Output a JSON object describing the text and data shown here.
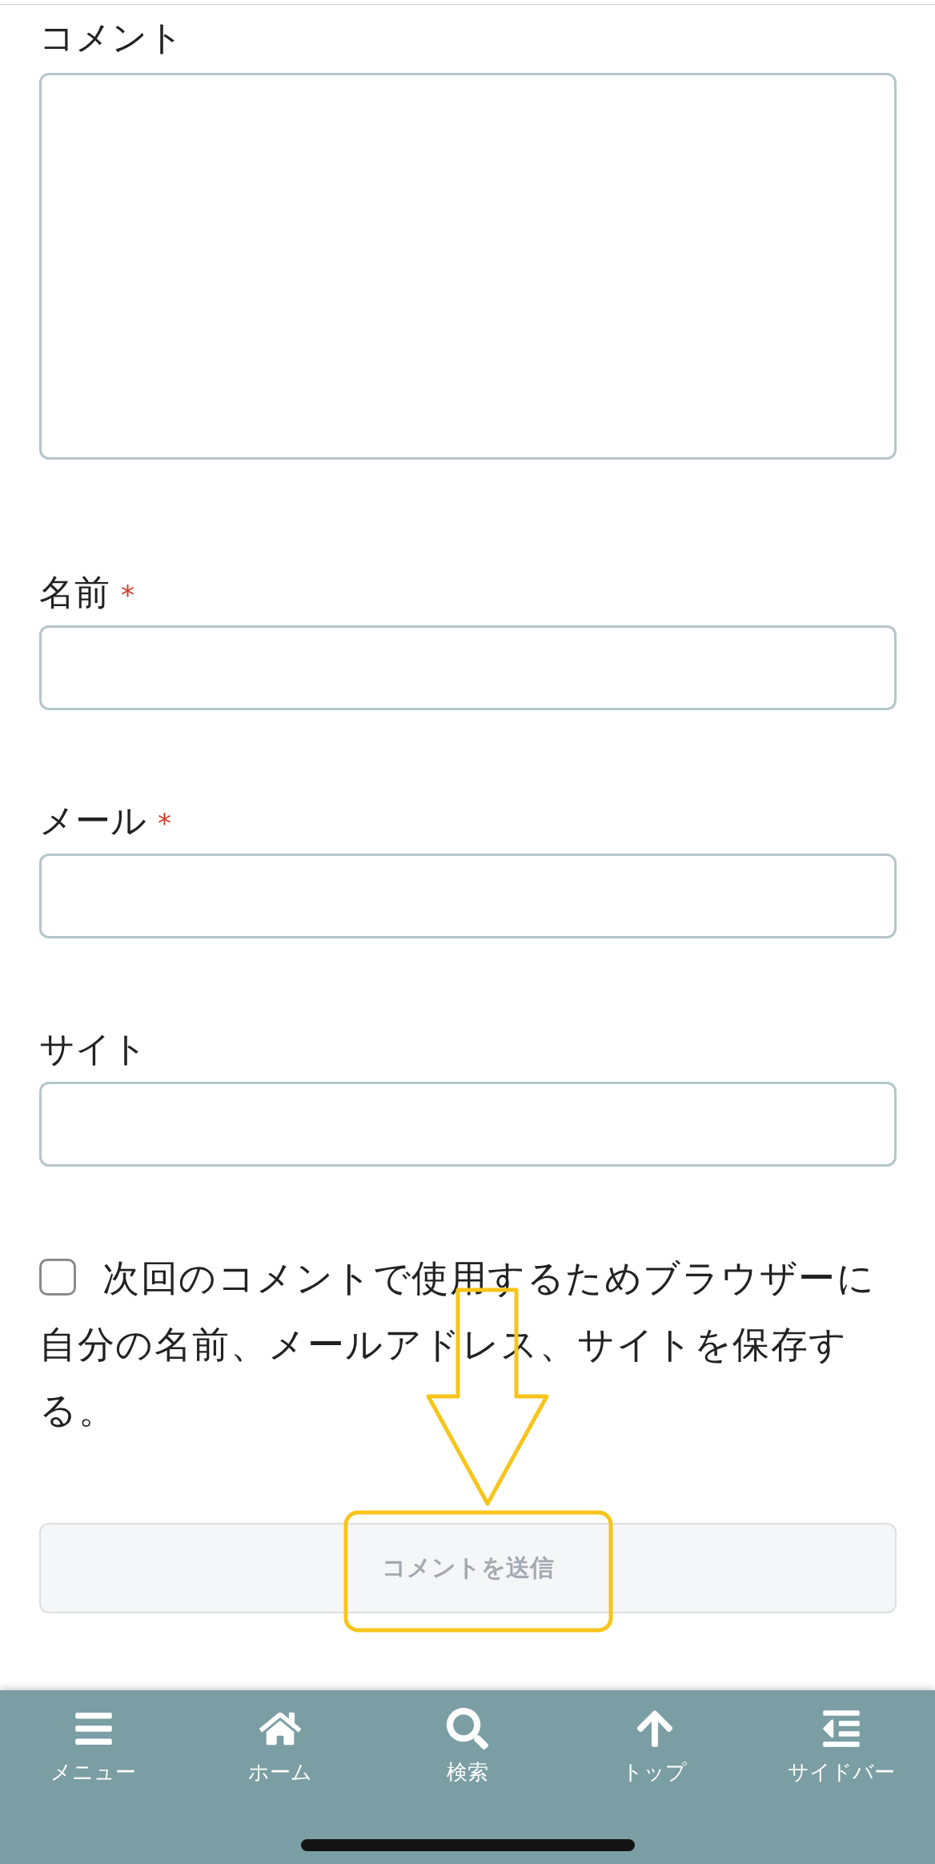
{
  "comment_form": {
    "fields": [
      {
        "kind": "textarea",
        "label": "コメント"
      },
      {
        "kind": "text",
        "label": "名前",
        "required_mark": "*"
      },
      {
        "kind": "text",
        "label": "メール",
        "required_mark": "*"
      },
      {
        "kind": "text",
        "label": "サイト"
      }
    ],
    "save_info": {
      "checked": false,
      "label": "次回のコメントで使用するためブラウザーに自分の名前、メールアドレス、サイトを保存する。"
    },
    "submit": {
      "label": "コメントを送信"
    }
  },
  "bottom_nav": {
    "items": [
      {
        "kind": "menu",
        "label": "メニュー"
      },
      {
        "kind": "home",
        "label": "ホーム"
      },
      {
        "kind": "search",
        "label": "検索"
      },
      {
        "kind": "top",
        "label": "トップ"
      },
      {
        "kind": "sidebar",
        "label": "サイドバー"
      }
    ]
  }
}
